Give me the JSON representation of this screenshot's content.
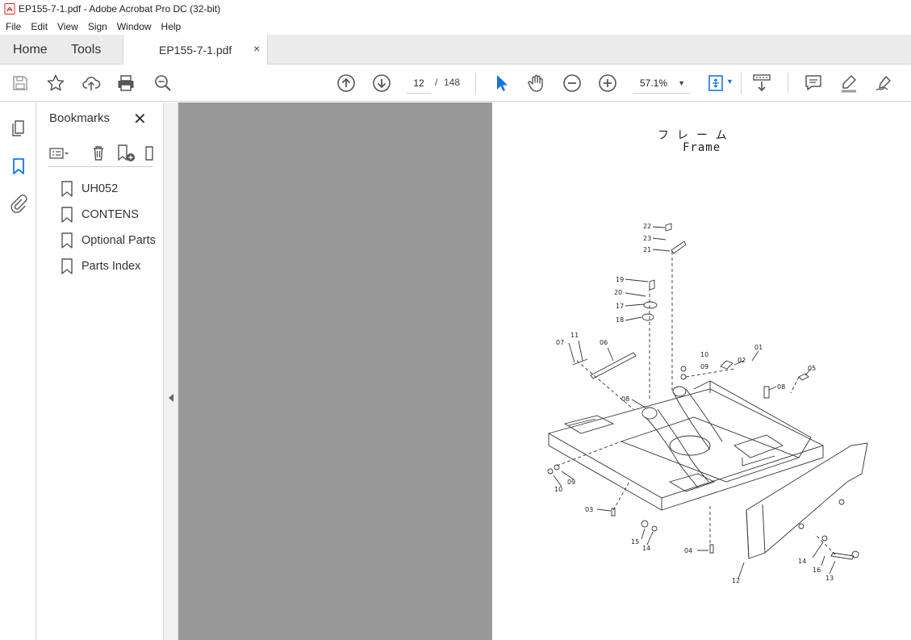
{
  "window": {
    "title": "EP155-7-1.pdf - Adobe Acrobat Pro DC (32-bit)",
    "app_icon": "acrobat-icon",
    "accent_color": "#d7271b"
  },
  "menu": [
    "File",
    "Edit",
    "View",
    "Sign",
    "Window",
    "Help"
  ],
  "tabs": {
    "home": "Home",
    "tools": "Tools",
    "document": "EP155-7-1.pdf",
    "document_close": "×"
  },
  "toolbar": {
    "icons": [
      "save-icon",
      "bookmark-star-icon",
      "cloud-upload-icon",
      "print-icon",
      "find-zoom-icon",
      "page-up-icon",
      "page-down-icon",
      "select-cursor-icon",
      "hand-icon",
      "zoom-out-icon",
      "zoom-in-icon",
      "fit-page-icon",
      "scroll-mode-icon",
      "comment-icon",
      "highlight-icon",
      "sign-icon"
    ],
    "current_page": "12",
    "page_separator": "/",
    "total_pages": "148",
    "zoom": "57.1%"
  },
  "rail": {
    "icons": [
      "page-thumbnails-icon",
      "bookmarks-icon",
      "attachments-icon"
    ]
  },
  "bookmarks": {
    "title": "Bookmarks",
    "close": "✕",
    "items": [
      "UH052",
      "CONTENS",
      "Optional Parts",
      "Parts Index"
    ]
  },
  "document": {
    "title_jp": "フレーム",
    "title_en": "Frame",
    "callouts": [
      "22",
      "23",
      "21",
      "19",
      "20",
      "17",
      "18",
      "11",
      "07",
      "06",
      "10",
      "09",
      "02",
      "01",
      "05",
      "08",
      "08",
      "10",
      "09",
      "03",
      "15",
      "14",
      "04",
      "14",
      "16",
      "13",
      "12"
    ]
  }
}
